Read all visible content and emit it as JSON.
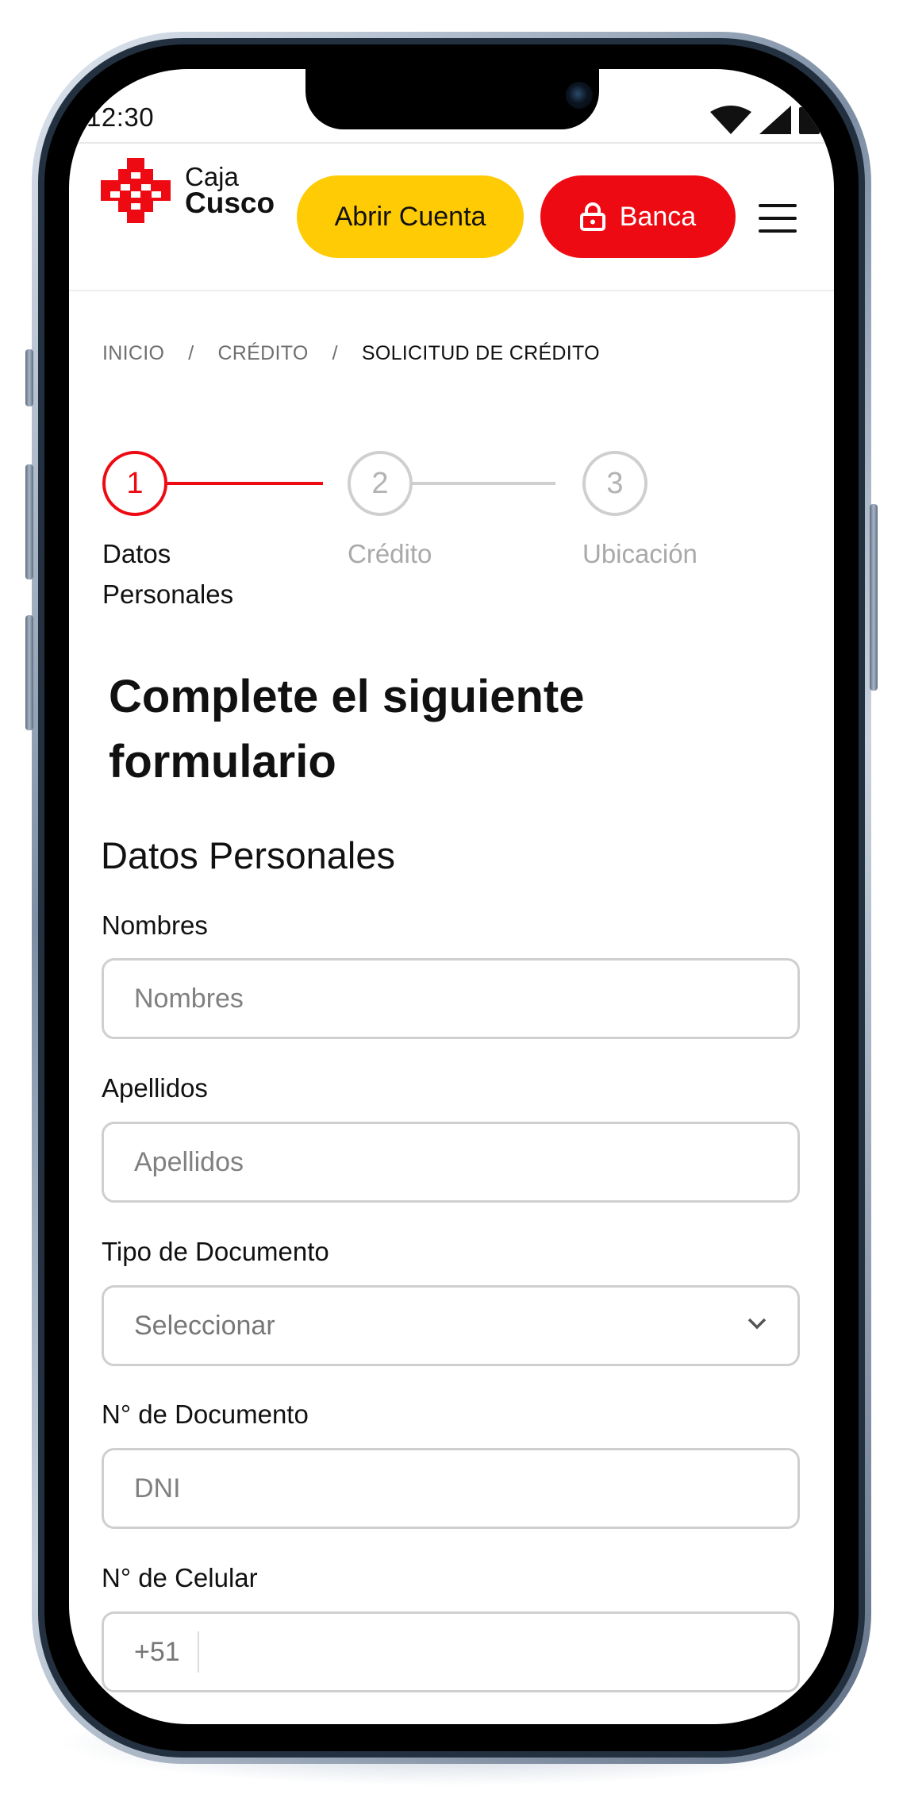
{
  "status_bar": {
    "time": "12:30"
  },
  "header": {
    "logo_line1": "Caja",
    "logo_line2": "Cusco",
    "open_account_label": "Abrir Cuenta",
    "banking_label": "Banca"
  },
  "breadcrumb": {
    "items": [
      "INICIO",
      "CRÉDITO",
      "SOLICITUD DE CRÉDITO"
    ],
    "separator": "/"
  },
  "stepper": {
    "steps": [
      {
        "number": "1",
        "label_line1": "Datos",
        "label_line2": "Personales",
        "state": "active"
      },
      {
        "number": "2",
        "label_line1": "Crédito",
        "label_line2": "",
        "state": "inactive"
      },
      {
        "number": "3",
        "label_line1": "Ubicación",
        "label_line2": "",
        "state": "inactive"
      }
    ]
  },
  "form": {
    "title": "Complete el siguiente formulario",
    "section_title": "Datos Personales",
    "fields": {
      "nombres": {
        "label": "Nombres",
        "placeholder": "Nombres",
        "value": ""
      },
      "apellidos": {
        "label": "Apellidos",
        "placeholder": "Apellidos",
        "value": ""
      },
      "tipo_documento": {
        "label": "Tipo de Documento",
        "selected": "Seleccionar"
      },
      "numero_documento": {
        "label": "N° de Documento",
        "placeholder": "DNI",
        "value": ""
      },
      "celular": {
        "label": "N° de Celular",
        "prefix": "+51",
        "value": ""
      }
    }
  },
  "colors": {
    "brand_red": "#ee0a13",
    "brand_yellow": "#ffcb05",
    "inactive_gray": "#b3b3b3",
    "border_gray": "#cfcfcf"
  },
  "icons": {
    "logo": "caja-cusco-logo",
    "lock": "lock-icon",
    "menu": "hamburger-menu-icon",
    "select": "chevron-down-icon",
    "wifi": "wifi-icon",
    "signal": "signal-icon",
    "battery": "battery-icon"
  }
}
